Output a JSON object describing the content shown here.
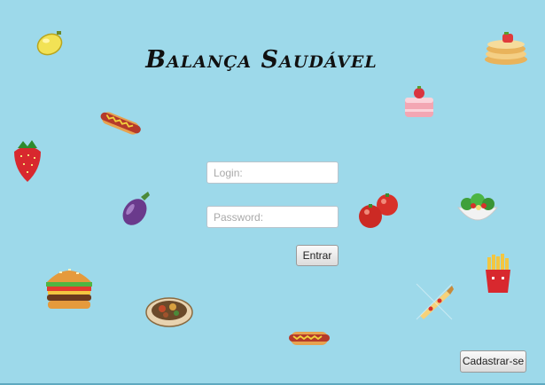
{
  "app": {
    "title": "Balança Saudável"
  },
  "login": {
    "login_placeholder": "Login:",
    "password_placeholder": "Password:",
    "submit_label": "Entrar"
  },
  "register_label": "Cadastrar-se",
  "decorations": [
    "lemon-icon",
    "pancakes-icon",
    "hotdog-icon",
    "cake-icon",
    "strawberry-icon",
    "eggplant-icon",
    "tomatoes-icon",
    "salad-icon",
    "fries-icon",
    "burger-icon",
    "stew-bowl-icon",
    "pizza-slice-icon",
    "hotdog-icon"
  ],
  "colors": {
    "background": "#9dd9ea"
  }
}
